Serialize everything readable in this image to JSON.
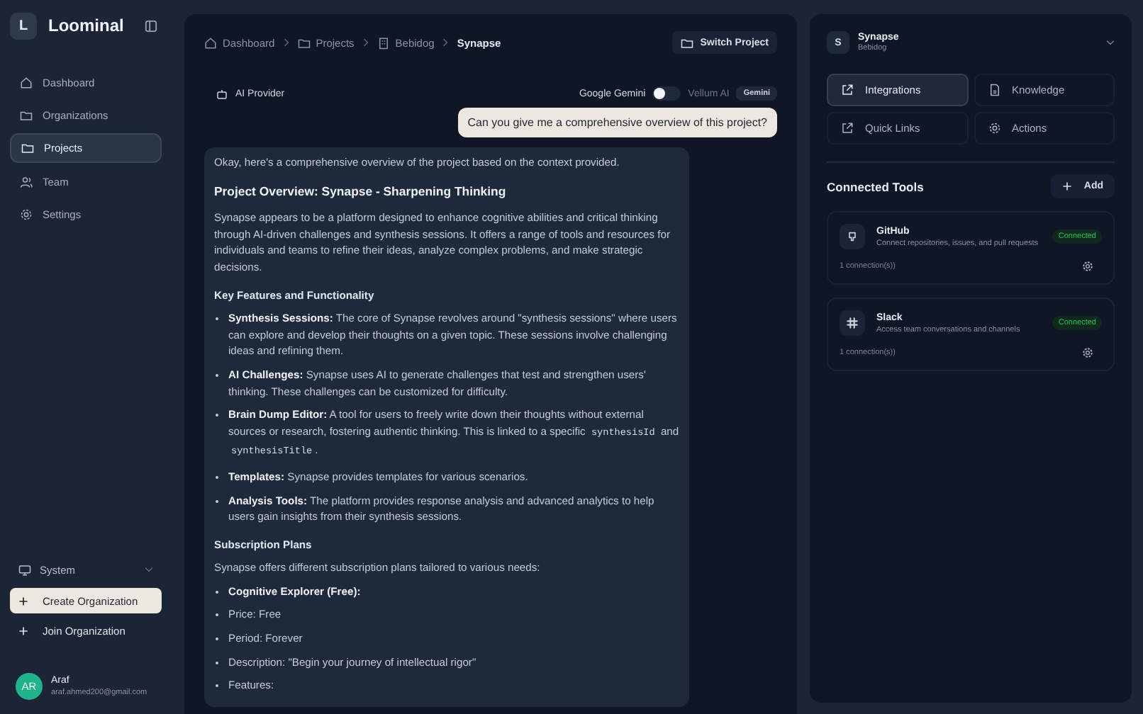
{
  "sidebar": {
    "logo_letter": "L",
    "app_name": "Loominal",
    "items": [
      {
        "label": "Dashboard",
        "selected": false
      },
      {
        "label": "Organizations",
        "selected": false
      },
      {
        "label": "Projects",
        "selected": true
      },
      {
        "label": "Team",
        "selected": false
      },
      {
        "label": "Settings",
        "selected": false
      }
    ],
    "theme": "System",
    "actions": [
      {
        "label": "Create Organization",
        "primary": true
      },
      {
        "label": "Join Organization",
        "primary": false
      }
    ],
    "user": {
      "initials": "AR",
      "name": "Araf",
      "email": "araf.ahmed200@gmail.com"
    }
  },
  "breadcrumbs": [
    {
      "label": "Dashboard"
    },
    {
      "label": "Projects"
    },
    {
      "label": "Bebidog"
    },
    {
      "label": "Synapse"
    }
  ],
  "switch_button": "Switch Project",
  "provider": {
    "label": "AI Provider",
    "left": "Google Gemini",
    "right": "Vellum AI",
    "on": false,
    "badge": "Gemini"
  },
  "user_message": "Can you give me a comprehensive overview of this project?",
  "reply": [
    {
      "kind": "para",
      "parts": [
        {
          "kind": "text",
          "text": "Okay, here's a comprehensive overview of the project based on the context provided."
        }
      ]
    },
    {
      "kind": "title",
      "parts": [
        {
          "kind": "text",
          "text": "Project Overview: Synapse - Sharpening Thinking"
        }
      ]
    },
    {
      "kind": "para",
      "parts": [
        {
          "kind": "text",
          "text": "Synapse appears to be a platform designed to enhance cognitive abilities and critical thinking through AI-driven challenges and synthesis sessions. It offers a range of tools and resources for individuals and teams to refine their ideas, analyze complex problems, and make strategic decisions."
        }
      ]
    },
    {
      "kind": "heading",
      "parts": [
        {
          "kind": "text",
          "text": "Key Features and Functionality"
        }
      ]
    },
    {
      "kind": "bullet",
      "parts": [
        {
          "kind": "text",
          "text": "**Synthesis Sessions:** The core of Synapse revolves around \"synthesis sessions\" where users can explore and develop their thoughts on a given topic. These sessions involve challenging ideas and refining them."
        }
      ]
    },
    {
      "kind": "bullet",
      "parts": [
        {
          "kind": "text",
          "text": "**AI Challenges:** Synapse uses AI to generate challenges that test and strengthen users' thinking. These challenges can be customized for difficulty."
        }
      ]
    },
    {
      "kind": "bullet",
      "parts": [
        {
          "kind": "text",
          "text": "**Brain Dump Editor:** A tool for users to freely write down their thoughts without external sources or research, fostering authentic thinking. This is linked to a specific "
        },
        {
          "kind": "code",
          "text": "synthesisId"
        },
        {
          "kind": "text",
          "text": " and "
        },
        {
          "kind": "code",
          "text": "synthesisTitle"
        },
        {
          "kind": "text",
          "text": "."
        }
      ]
    },
    {
      "kind": "bullet",
      "parts": [
        {
          "kind": "text",
          "text": "**Templates:** Synapse provides templates for various scenarios."
        }
      ]
    },
    {
      "kind": "bullet",
      "parts": [
        {
          "kind": "text",
          "text": "**Analysis Tools:** The platform provides response analysis and advanced analytics to help users gain insights from their synthesis sessions."
        }
      ]
    },
    {
      "kind": "heading",
      "parts": [
        {
          "kind": "text",
          "text": "Subscription Plans"
        }
      ]
    },
    {
      "kind": "para",
      "parts": [
        {
          "kind": "text",
          "text": "Synapse offers different subscription plans tailored to various needs:"
        }
      ]
    },
    {
      "kind": "bullet",
      "parts": [
        {
          "kind": "text",
          "text": "**Cognitive Explorer (Free):**"
        }
      ]
    },
    {
      "kind": "bullet",
      "parts": [
        {
          "kind": "text",
          "text": "Price: Free"
        }
      ]
    },
    {
      "kind": "bullet",
      "parts": [
        {
          "kind": "text",
          "text": "Period: Forever"
        }
      ]
    },
    {
      "kind": "bullet",
      "parts": [
        {
          "kind": "text",
          "text": "Description: \"Begin your journey of intellectual rigor\""
        }
      ]
    },
    {
      "kind": "bullet",
      "parts": [
        {
          "kind": "text",
          "text": "Features:"
        }
      ]
    }
  ],
  "right_panel": {
    "project": {
      "letter": "S",
      "name": "Synapse",
      "org": "Bebidog"
    },
    "tabs": [
      {
        "label": "Integrations",
        "selected": true
      },
      {
        "label": "Knowledge",
        "selected": false
      },
      {
        "label": "Quick Links",
        "selected": false
      },
      {
        "label": "Actions",
        "selected": false
      }
    ],
    "section_title": "Connected Tools",
    "add_button": "Add",
    "tools": [
      {
        "name": "GitHub",
        "description": "Connect repositories, issues, and pull requests",
        "status": "Connected",
        "connections": "1 connection(s))"
      },
      {
        "name": "Slack",
        "description": "Access team conversations and channels",
        "status": "Connected",
        "connections": "1 connection(s))"
      }
    ]
  }
}
